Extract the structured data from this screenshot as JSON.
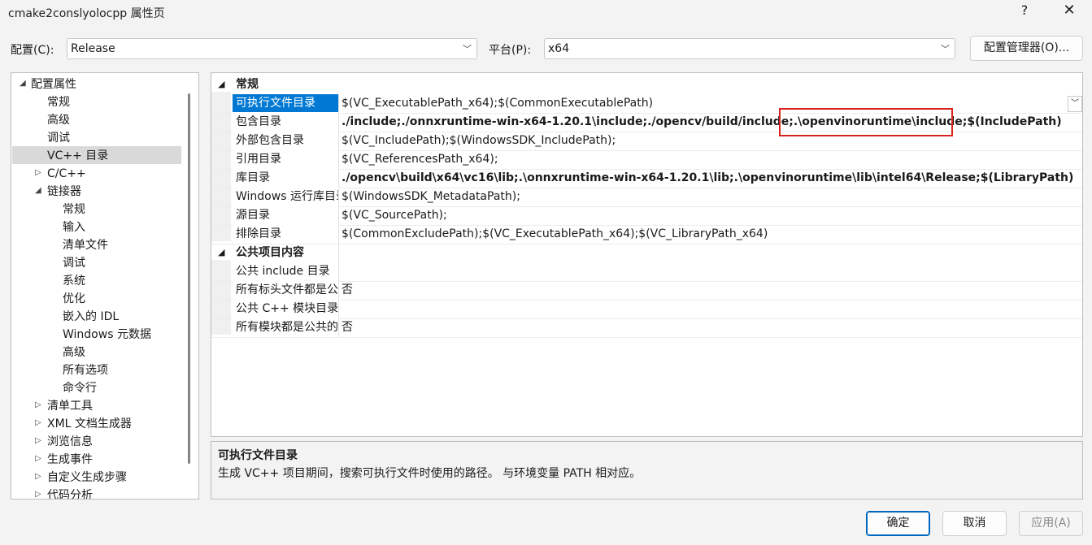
{
  "window": {
    "title": "cmake2conslyolocpp 属性页",
    "help_glyph": "?",
    "close_glyph": "✕"
  },
  "toolbar": {
    "config_label": "配置(C):",
    "config_value": "Release",
    "platform_label": "平台(P):",
    "platform_value": "x64",
    "config_manager_label": "配置管理器(O)..."
  },
  "tree": {
    "items": [
      {
        "label": "配置属性",
        "expander": "◢"
      },
      {
        "label": "常规"
      },
      {
        "label": "高级"
      },
      {
        "label": "调试"
      },
      {
        "label": "VC++ 目录",
        "selected": true
      },
      {
        "label": "C/C++",
        "expander": "▷"
      },
      {
        "label": "链接器",
        "expander": "◢"
      },
      {
        "label": "常规"
      },
      {
        "label": "输入"
      },
      {
        "label": "清单文件"
      },
      {
        "label": "调试"
      },
      {
        "label": "系统"
      },
      {
        "label": "优化"
      },
      {
        "label": "嵌入的 IDL"
      },
      {
        "label": "Windows 元数据"
      },
      {
        "label": "高级"
      },
      {
        "label": "所有选项"
      },
      {
        "label": "命令行"
      },
      {
        "label": "清单工具",
        "expander": "▷"
      },
      {
        "label": "XML 文档生成器",
        "expander": "▷"
      },
      {
        "label": "浏览信息",
        "expander": "▷"
      },
      {
        "label": "生成事件",
        "expander": "▷"
      },
      {
        "label": "自定义生成步骤",
        "expander": "▷"
      },
      {
        "label": "代码分析",
        "expander": "▷"
      }
    ]
  },
  "grid": {
    "categories": [
      {
        "title": "常规",
        "rows": [
          {
            "name": "可执行文件目录",
            "value": "$(VC_ExecutablePath_x64);$(CommonExecutablePath)",
            "bold": false,
            "selected": true
          },
          {
            "name": "包含目录",
            "value": "./include;./onnxruntime-win-x64-1.20.1\\include;./opencv/build/include;.\\openvinoruntime\\include;$(IncludePath)",
            "bold": true
          },
          {
            "name": "外部包含目录",
            "value": "$(VC_IncludePath);$(WindowsSDK_IncludePath);",
            "bold": false
          },
          {
            "name": "引用目录",
            "value": "$(VC_ReferencesPath_x64);",
            "bold": false
          },
          {
            "name": "库目录",
            "value": "./opencv\\build\\x64\\vc16\\lib;.\\onnxruntime-win-x64-1.20.1\\lib;.\\openvinoruntime\\lib\\intel64\\Release;$(LibraryPath)",
            "bold": true
          },
          {
            "name": "Windows 运行库目录",
            "value": "$(WindowsSDK_MetadataPath);",
            "bold": false
          },
          {
            "name": "源目录",
            "value": "$(VC_SourcePath);",
            "bold": false
          },
          {
            "name": "排除目录",
            "value": "$(CommonExcludePath);$(VC_ExecutablePath_x64);$(VC_LibraryPath_x64)",
            "bold": false
          }
        ]
      },
      {
        "title": "公共项目内容",
        "rows": [
          {
            "name": "公共 include 目录",
            "value": "",
            "bold": false
          },
          {
            "name": "所有标头文件都是公共的",
            "value": "否",
            "bold": false
          },
          {
            "name": "公共 C++ 模块目录",
            "value": "",
            "bold": false
          },
          {
            "name": "所有模块都是公共的",
            "value": "否",
            "bold": false
          }
        ]
      }
    ],
    "dropdown_glyph": "﹀"
  },
  "description": {
    "title": "可执行文件目录",
    "text": "生成 VC++ 项目期间，搜索可执行文件时使用的路径。 与环境变量 PATH 相对应。"
  },
  "buttons": {
    "ok": "确定",
    "cancel": "取消",
    "apply": "应用(A)"
  },
  "colors": {
    "selection": "#0078d4",
    "highlight_box": "#d9231f"
  }
}
